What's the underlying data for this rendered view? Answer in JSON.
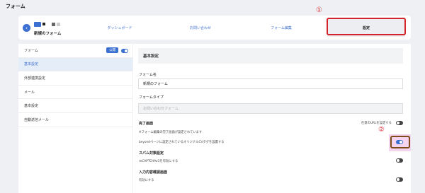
{
  "page_title": "フォーム",
  "header": {
    "form_name": "新規のフォーム",
    "tabs": [
      "ダッシュボード",
      "お問い合わせ",
      "フォーム編集",
      "設定"
    ]
  },
  "annotations": {
    "marker_1": "①",
    "marker_2": "②"
  },
  "sidebar": {
    "status_badge": "公開",
    "items": [
      "フォーム",
      "基本設定",
      "外部連携設定",
      "メール",
      "基本設定",
      "自動返信メール"
    ]
  },
  "main": {
    "section_title": "基本設定",
    "form_name_label": "フォーム名",
    "form_name_value": "新規のフォーム",
    "form_type_label": "フォームタイプ",
    "form_type_value": "お問い合わせフォーム",
    "completion_label": "完了画面",
    "arbitrary_url_label": "任意のURLを設定する",
    "completion_note": "※フォーム編集の完了画面が設定されています",
    "cv_tag_label": "beyondページに設定されているオリジナルCVタグを設置する",
    "spam_label": "スパム対策設定",
    "recaptcha_label": "reCAPTCHAv3を有効にする",
    "confirm_label": "入力内容確認画面",
    "enable_label": "有効にする"
  },
  "colors": {
    "accent": "#3b6fd1",
    "annotation_red": "#d3252a",
    "annotation_brown": "#7d4c18",
    "highlight": "#f5d4f0"
  }
}
